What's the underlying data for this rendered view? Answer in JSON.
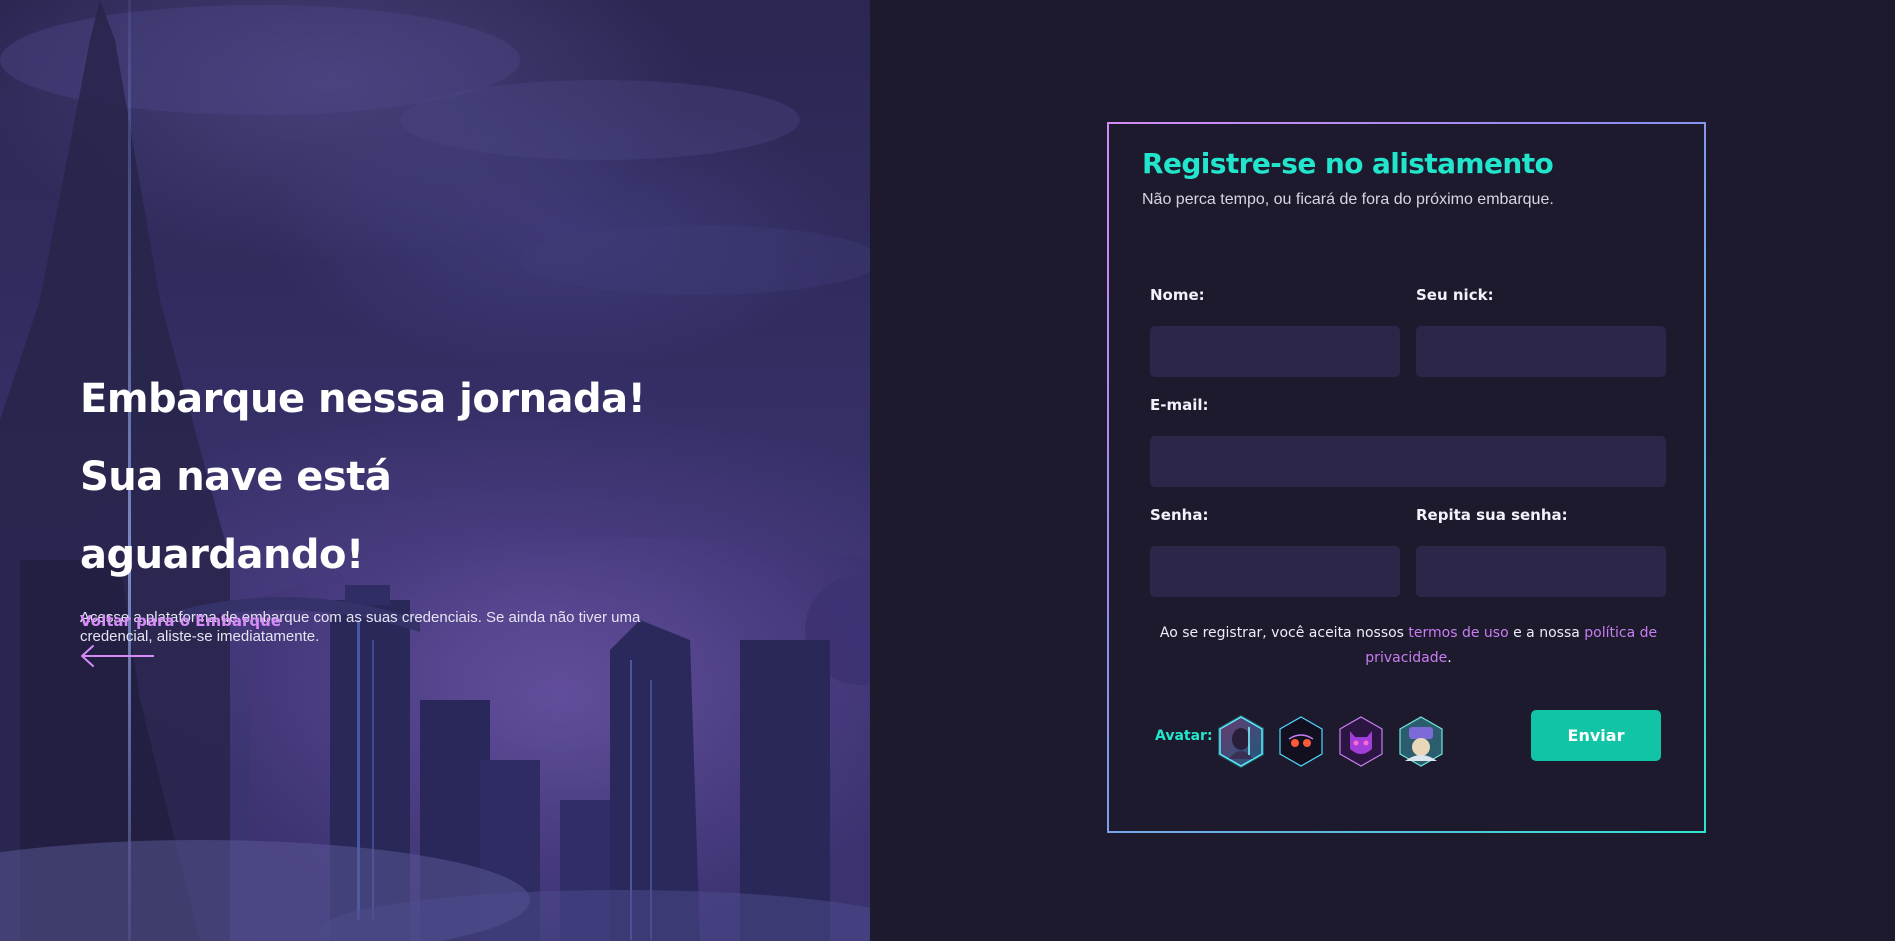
{
  "hero": {
    "title_line1": "Embarque nessa jornada!",
    "title_line2": "Sua nave está aguardando!",
    "description": "Acesse a plataforma de embarque com as suas credenciais. Se ainda não tiver uma credencial, aliste-se imediatamente.",
    "back_link": "Voltar para o Embarque",
    "back_icon": "arrow-left-icon"
  },
  "form": {
    "title": "Registre-se no alistamento",
    "subtitle": "Não perca tempo, ou ficará de fora do próximo embarque.",
    "fields": {
      "name_label": "Nome:",
      "nick_label": "Seu nick:",
      "email_label": "E-mail:",
      "password_label": "Senha:",
      "repeat_password_label": "Repita sua senha:",
      "name_value": "",
      "nick_value": "",
      "email_value": "",
      "password_value": "",
      "repeat_password_value": ""
    },
    "terms": {
      "prefix": "Ao se registrar, você aceita nossos ",
      "terms_link": "termos de uso",
      "middle": " e a nossa ",
      "privacy_link": "política de privacidade",
      "suffix": "."
    },
    "avatar_label": "Avatar:",
    "avatars": [
      "avatar-1-hooded",
      "avatar-2-robot",
      "avatar-3-cat-mask",
      "avatar-4-gamer"
    ],
    "selected_avatar": 0,
    "submit_label": "Enviar"
  },
  "colors": {
    "accent_cyan": "#22e6cc",
    "accent_purple": "#d58cf5",
    "button": "#12c4a6",
    "background": "#1e1a2e",
    "input_bg": "#2c2748"
  }
}
